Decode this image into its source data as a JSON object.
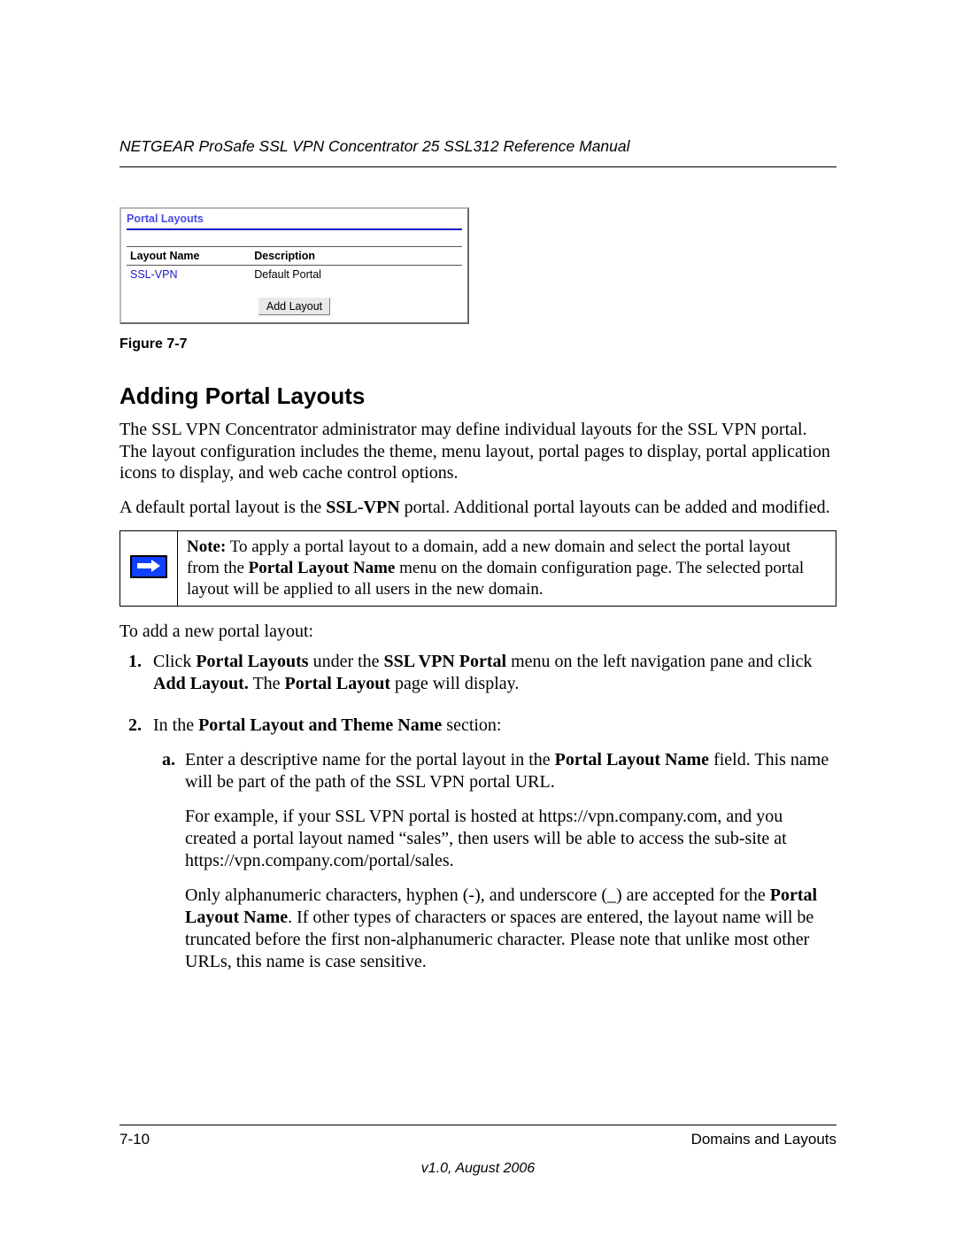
{
  "header": {
    "running_title": "NETGEAR ProSafe SSL VPN Concentrator 25 SSL312 Reference Manual"
  },
  "figure": {
    "panel_title": "Portal Layouts",
    "columns": {
      "name": "Layout Name",
      "desc": "Description"
    },
    "rows": [
      {
        "name": "SSL-VPN",
        "desc": "Default Portal"
      }
    ],
    "add_button": "Add Layout",
    "caption": "Figure 7-7"
  },
  "section": {
    "heading": "Adding Portal Layouts",
    "p1": "The SSL VPN Concentrator administrator may define individual layouts for the SSL VPN portal. The layout configuration includes the theme, menu layout, portal pages to display, portal application icons to display, and web cache control options.",
    "p2_pre": "A default portal layout is the ",
    "p2_bold": "SSL-VPN",
    "p2_post": " portal. Additional portal layouts can be added and modified.",
    "note": {
      "label": "Note:",
      "t1": " To apply a portal layout to a domain, add a new domain and select the portal layout from the ",
      "b1": "Portal Layout Name",
      "t2": " menu on the domain configuration page. The selected portal layout will be applied to all users in the new domain."
    },
    "intro_list": "To add a new portal layout:",
    "step1": {
      "t1": "Click ",
      "b1": "Portal Layouts",
      "t2": " under the ",
      "b2": "SSL VPN Portal",
      "t3": " menu on the left navigation pane and click ",
      "b3": "Add Layout.",
      "t4": " The ",
      "b4": "Portal Layout",
      "t5": " page will display."
    },
    "step2": {
      "t1": "In the ",
      "b1": "Portal Layout and Theme Name",
      "t2": " section:",
      "a": {
        "t1": "Enter a descriptive name for the portal layout in the ",
        "b1": "Portal Layout Name",
        "t2": " field. This name will be part of the path of the SSL VPN portal URL.",
        "p2": "For example, if your SSL VPN portal is hosted at https://vpn.company.com, and you created a portal layout named “sales”, then users will be able to access the sub-site at https://vpn.company.com/portal/sales.",
        "p3_t1": "Only alphanumeric characters, hyphen (-), and underscore (_) are accepted for the ",
        "p3_b1": "Portal Layout Name",
        "p3_t2": ". If other types of characters or spaces are entered, the layout name will be truncated before the first non-alphanumeric character. Please note that unlike most other URLs, this name is case sensitive."
      }
    }
  },
  "footer": {
    "page_num": "7-10",
    "chapter": "Domains and Layouts",
    "version": "v1.0, August 2006"
  }
}
